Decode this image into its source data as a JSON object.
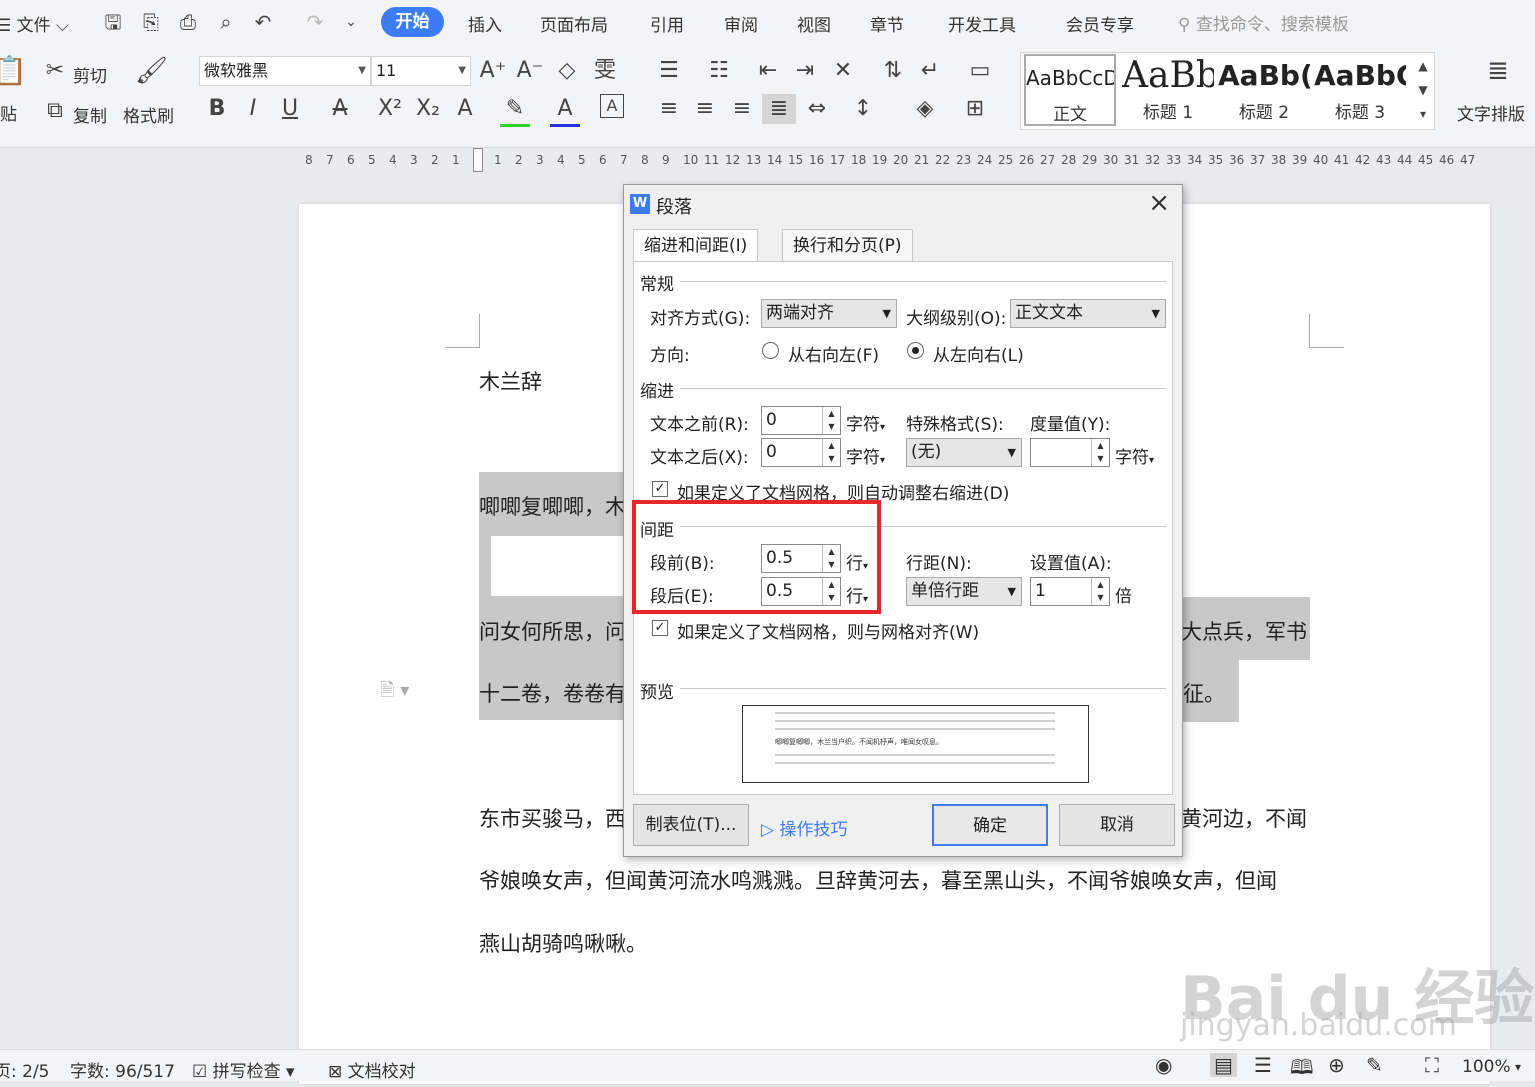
{
  "menubar": {
    "file": "文件",
    "tabs": [
      "开始",
      "插入",
      "页面布局",
      "引用",
      "审阅",
      "视图",
      "章节",
      "开发工具",
      "会员专享"
    ],
    "search": "查找命令、搜索模板"
  },
  "ribbon": {
    "paste": "贴",
    "cut": "剪切",
    "copy": "复制",
    "format_painter": "格式刷",
    "font_name": "微软雅黑",
    "font_size": "11",
    "styles": [
      {
        "preview": "AaBbCcDc",
        "label": "正文"
      },
      {
        "preview": "AaBb",
        "label": "标题 1"
      },
      {
        "preview": "AaBb(",
        "label": "标题 2"
      },
      {
        "preview": "AaBbC",
        "label": "标题 3"
      }
    ],
    "text_layout": "文字排版"
  },
  "ruler": {
    "left_numbers": [
      "8",
      "7",
      "6",
      "5",
      "4",
      "3",
      "2",
      "1"
    ],
    "right_numbers": [
      "1",
      "2",
      "3",
      "4",
      "5",
      "6",
      "7",
      "8",
      "9",
      "10",
      "11",
      "12",
      "13",
      "14",
      "15",
      "16",
      "17",
      "18",
      "19",
      "20",
      "21",
      "22",
      "23",
      "24",
      "25",
      "26",
      "27",
      "28",
      "29",
      "30",
      "31",
      "32",
      "33",
      "34",
      "35",
      "36",
      "37",
      "38",
      "39",
      "40",
      "41",
      "42",
      "43",
      "44",
      "45",
      "46",
      "47"
    ]
  },
  "document": {
    "title": "木兰辞",
    "p1": "唧唧复唧唧，木",
    "p2_start": "问女何所思，问",
    "p2_end": "大点兵，军书",
    "p3_start": "十二卷，卷卷有",
    "p3_end": "征。",
    "p4_start": "东市买骏马，西",
    "p4_end": "黄河边，不闻",
    "p5": "爷娘唤女声，但闻黄河流水鸣溅溅。旦辞黄河去，暮至黑山头，不闻爷娘唤女声，但闻",
    "p6": "燕山胡骑鸣啾啾。"
  },
  "dialog": {
    "title": "段落",
    "tabs": [
      "缩进和间距(I)",
      "换行和分页(P)"
    ],
    "general": {
      "section": "常规",
      "align_label": "对齐方式(G):",
      "align_value": "两端对齐",
      "outline_label": "大纲级别(O):",
      "outline_value": "正文文本",
      "direction_label": "方向:",
      "rtl": "从右向左(F)",
      "ltr": "从左向右(L)"
    },
    "indent": {
      "section": "缩进",
      "before_label": "文本之前(R):",
      "before_value": "0",
      "after_label": "文本之后(X):",
      "after_value": "0",
      "unit": "字符",
      "special_label": "特殊格式(S):",
      "special_value": "(无)",
      "measure_label": "度量值(Y):",
      "measure_value": "",
      "auto_adjust": "如果定义了文档网格，则自动调整右缩进(D)"
    },
    "spacing": {
      "section": "间距",
      "before_label": "段前(B):",
      "before_value": "0.5",
      "after_label": "段后(E):",
      "after_value": "0.5",
      "unit": "行",
      "line_label": "行距(N):",
      "line_value": "单倍行距",
      "set_label": "设置值(A):",
      "set_value": "1",
      "set_unit": "倍",
      "grid_align": "如果定义了文档网格，则与网格对齐(W)"
    },
    "preview": {
      "section": "预览",
      "sample": "唧唧复唧唧，木兰当户织。不闻机杼声，唯闻女叹息。"
    },
    "buttons": {
      "tabs": "制表位(T)...",
      "tips": "操作技巧",
      "ok": "确定",
      "cancel": "取消"
    }
  },
  "status": {
    "page": "页: 2/5",
    "words": "字数: 96/517",
    "spell": "拼写检查",
    "proof": "文档校对",
    "zoom": "100%"
  },
  "watermark": {
    "text": "Bai du 经验",
    "sub": "jingyan.baidu.com"
  }
}
